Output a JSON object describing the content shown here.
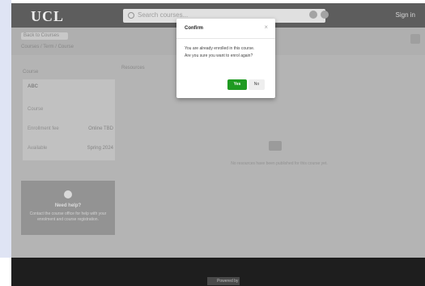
{
  "header": {
    "logo": "UCL",
    "search_placeholder": "Search courses...",
    "right_text": "Sign in"
  },
  "subheader": {
    "chip_label": "Back to Courses",
    "breadcrumb": "Courses / Term / Course"
  },
  "sidebar": {
    "section_label": "Course",
    "card_title": "ABC",
    "rows": [
      {
        "label": "Course",
        "value": ""
      },
      {
        "label": "Enrollment fee",
        "value": "Online TBD"
      },
      {
        "label": "Available",
        "value": "Spring 2024"
      }
    ],
    "info_card": {
      "title": "Need help?",
      "text": "Contact the course office for help with your enrolment and course registration."
    }
  },
  "content": {
    "label": "Resources",
    "empty_text": "No resources have been published for this course yet."
  },
  "footer": {
    "badge": "Powered by"
  },
  "dialog": {
    "title": "Confirm",
    "close_icon": "close-icon",
    "message_line1": "You are already enrolled in this course.",
    "message_line2": "Are you sure you want to enrol again?",
    "yes_label": "Yes",
    "no_label": "No",
    "yes_color": "#1f9a21"
  }
}
